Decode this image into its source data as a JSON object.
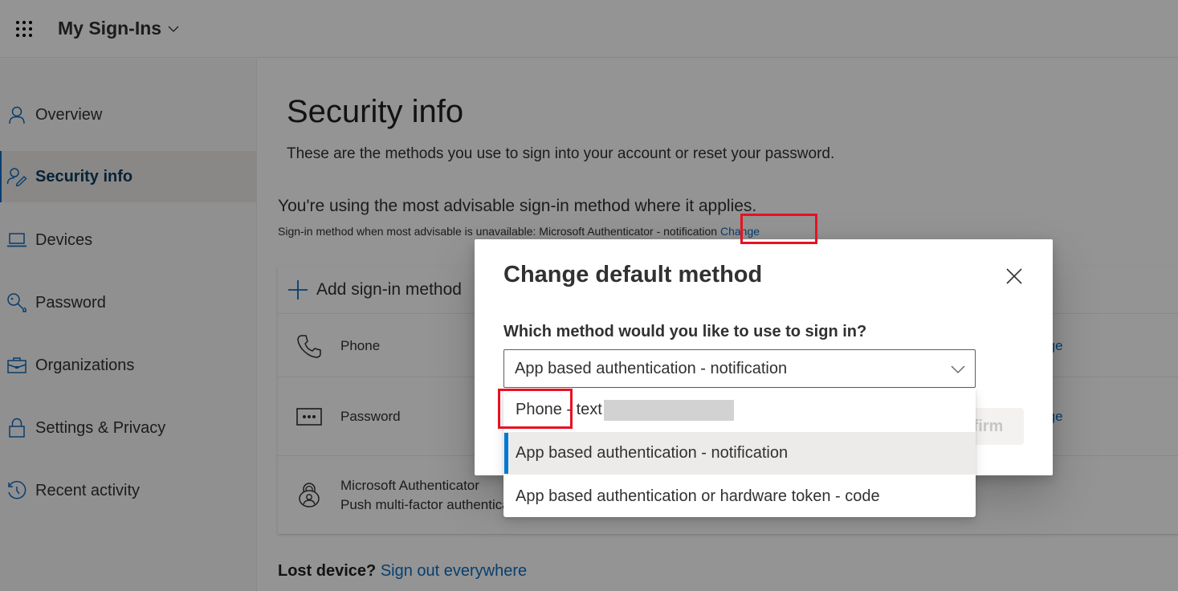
{
  "header": {
    "app_title": "My Sign-Ins",
    "waffle_icon": "app-launcher-icon",
    "chevron_icon": "chevron-down-icon"
  },
  "sidebar": {
    "items": [
      {
        "label": "Overview",
        "icon": "person-icon",
        "active": false
      },
      {
        "label": "Security info",
        "icon": "person-edit-icon",
        "active": true
      },
      {
        "label": "Devices",
        "icon": "laptop-icon",
        "active": false
      },
      {
        "label": "Password",
        "icon": "key-icon",
        "active": false
      },
      {
        "label": "Organizations",
        "icon": "briefcase-icon",
        "active": false
      },
      {
        "label": "Settings & Privacy",
        "icon": "lock-icon",
        "active": false
      },
      {
        "label": "Recent activity",
        "icon": "history-icon",
        "active": false
      }
    ]
  },
  "main": {
    "title": "Security info",
    "subtitle": "These are the methods you use to sign into your account or reset your password.",
    "advisable_text": "You're using the most advisable sign-in method where it applies.",
    "fallback_text": "Sign-in method when most advisable is unavailable: Microsoft Authenticator - notification",
    "fallback_change_link": "Change",
    "add_method_label": "Add sign-in method",
    "methods": [
      {
        "title": "Phone",
        "detail": "",
        "icon": "phone-icon",
        "action": "Change"
      },
      {
        "title": "Password",
        "detail": "",
        "icon": "password-dots-icon",
        "action": "Change"
      },
      {
        "title": "Microsoft Authenticator",
        "detail": "Push multi-factor authentication (MFA)",
        "icon": "authenticator-icon",
        "action": ""
      }
    ],
    "lost_device_label": "Lost device?",
    "sign_out_link": "Sign out everywhere"
  },
  "dialog": {
    "title": "Change default method",
    "close_icon": "close-icon",
    "question": "Which method would you like to use to sign in?",
    "selected_value": "App based authentication - notification",
    "confirm_label": "Confirm",
    "options": [
      {
        "label": "Phone - text",
        "redacted_suffix": true,
        "selected": false
      },
      {
        "label": "App based authentication - notification",
        "selected": true
      },
      {
        "label": "App based authentication or hardware token - code",
        "selected": false
      }
    ]
  },
  "annotations": {
    "highlight_color": "#e81123",
    "highlighted": [
      "fallback-change-link",
      "option-phone-text"
    ]
  },
  "colors": {
    "accent": "#0f6cbd",
    "selected_indicator": "#0078d4"
  }
}
